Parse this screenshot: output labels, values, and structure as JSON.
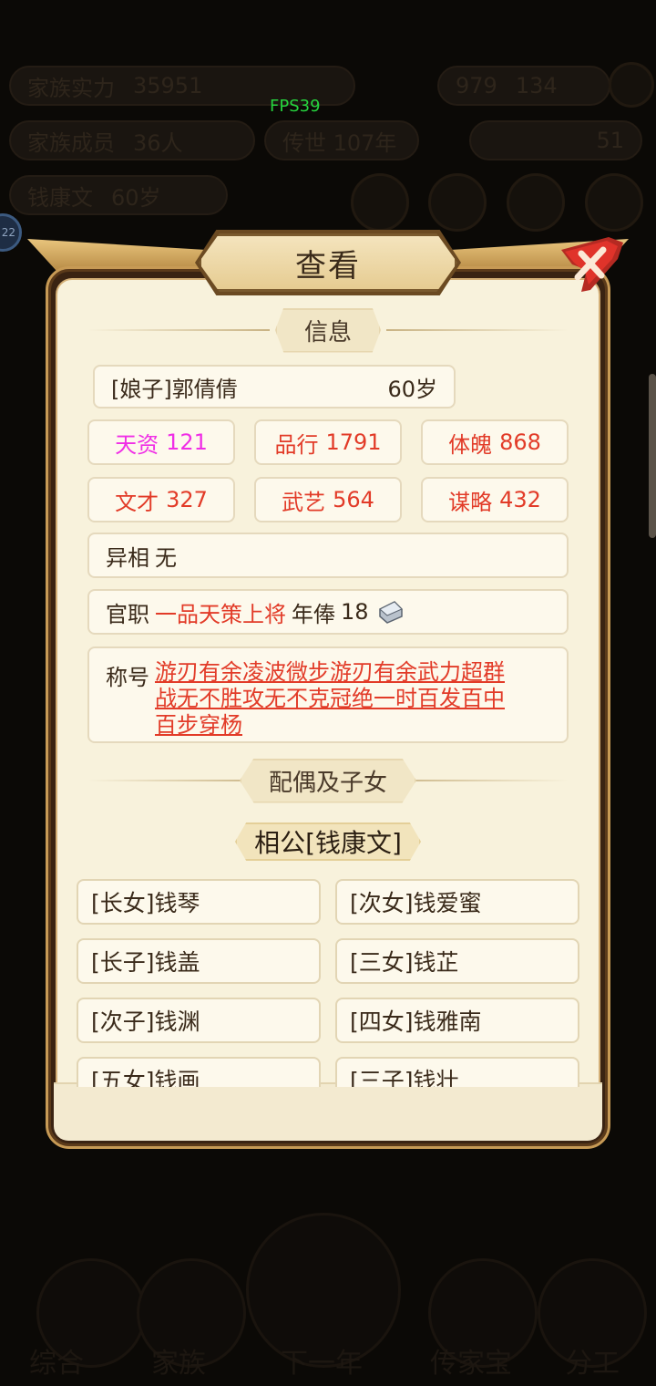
{
  "fps": "FPS39",
  "background": {
    "pills": [
      "家族实力",
      "35951",
      "979",
      "134",
      "家族成员",
      "36人",
      "传世 107年",
      "51",
      "钱康文",
      "60岁"
    ],
    "tabs": [
      "综合",
      "家族",
      "下一年",
      "传家宝",
      "分工"
    ],
    "badge": "22"
  },
  "dialog": {
    "title": "查看",
    "info_header": "信息",
    "person": {
      "name": "[娘子]郭倩倩",
      "age": "60岁"
    },
    "stats": [
      {
        "label": "天资",
        "value": "121",
        "color": "#f02ee6"
      },
      {
        "label": "品行",
        "value": "1791",
        "color": "#e23b28"
      },
      {
        "label": "体魄",
        "value": "868",
        "color": "#e23b28"
      },
      {
        "label": "文才",
        "value": "327",
        "color": "#e23b28"
      },
      {
        "label": "武艺",
        "value": "564",
        "color": "#e23b28"
      },
      {
        "label": "谋略",
        "value": "432",
        "color": "#e23b28"
      }
    ],
    "trait_label": "异相",
    "trait_value": "无",
    "office_label": "官职",
    "office_value": "一品天策上将",
    "salary_label": "年俸",
    "salary_value": "18",
    "salary_icon": "silver-ingot-icon",
    "title_label": "称号",
    "titles": [
      "游刃有余凌波微步游刃有余武力超群",
      "战无不胜攻无不克冠绝一时百发百中",
      "百步穿杨"
    ],
    "family_header": "配偶及子女",
    "spouse": "相公[钱康文]",
    "children": [
      "[长女]钱琴",
      "[次女]钱爱蜜",
      "[长子]钱盖",
      "[三女]钱芷",
      "[次子]钱渊",
      "[四女]钱雅南",
      "[五女]钱画",
      "[三子]钱壮"
    ]
  },
  "colors": {
    "accent_gold": "#c79a55",
    "parchment": "#f8f2dc",
    "stat_red": "#e23b28",
    "stat_pink": "#f02ee6",
    "close_red": "#e0332a"
  }
}
